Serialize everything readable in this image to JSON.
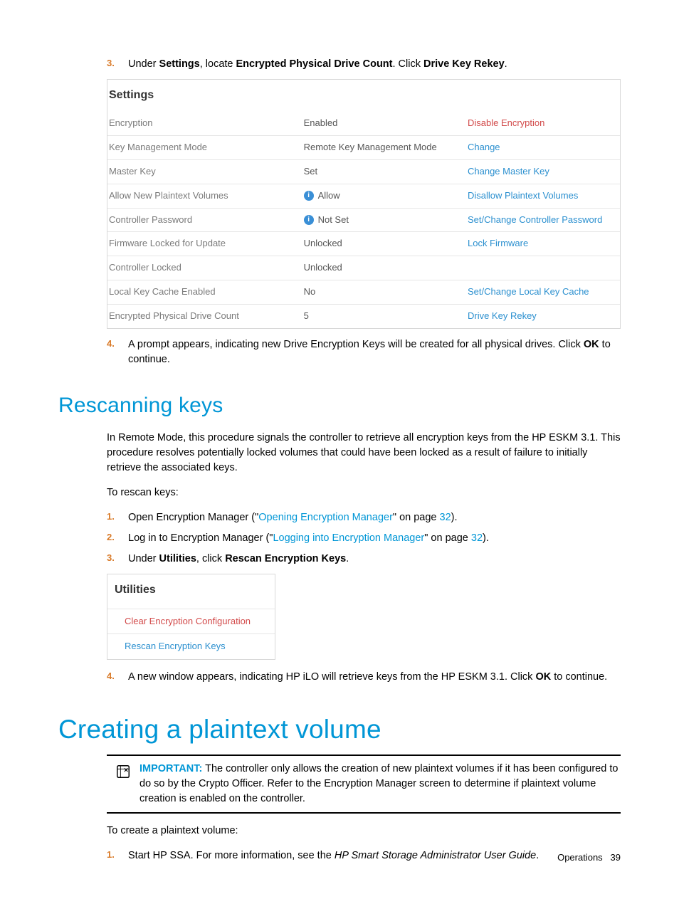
{
  "step3": {
    "num": "3.",
    "text_a": "Under ",
    "b1": "Settings",
    "text_b": ", locate ",
    "b2": "Encrypted Physical Drive Count",
    "text_c": ". Click ",
    "b3": "Drive Key Rekey",
    "text_d": "."
  },
  "settings_img": {
    "title": "Settings",
    "rows": [
      {
        "label": "Encryption",
        "value": "Enabled",
        "action": "Disable Encryption",
        "info": false,
        "red": true
      },
      {
        "label": "Key Management Mode",
        "value": "Remote Key Management Mode",
        "action": "Change",
        "info": false,
        "red": false
      },
      {
        "label": "Master Key",
        "value": "Set",
        "action": "Change Master Key",
        "info": false,
        "red": false
      },
      {
        "label": "Allow New Plaintext Volumes",
        "value": "Allow",
        "action": "Disallow Plaintext Volumes",
        "info": true,
        "red": false
      },
      {
        "label": "Controller Password",
        "value": "Not Set",
        "action": "Set/Change Controller Password",
        "info": true,
        "red": false
      },
      {
        "label": "Firmware Locked for Update",
        "value": "Unlocked",
        "action": "Lock Firmware",
        "info": false,
        "red": false
      },
      {
        "label": "Controller Locked",
        "value": "Unlocked",
        "action": "",
        "info": false,
        "red": false
      },
      {
        "label": "Local Key Cache Enabled",
        "value": "No",
        "action": "Set/Change Local Key Cache",
        "info": false,
        "red": false
      },
      {
        "label": "Encrypted Physical Drive Count",
        "value": "5",
        "action": "Drive Key Rekey",
        "info": false,
        "red": false
      }
    ]
  },
  "step4": {
    "num": "4.",
    "text_a": "A prompt appears, indicating new Drive Encryption Keys will be created for all physical drives. Click ",
    "b1": "OK",
    "text_b": " to continue."
  },
  "h2_rescanning": "Rescanning keys",
  "rescan_intro": "In Remote Mode, this procedure signals the controller to retrieve all encryption keys from the HP ESKM 3.1. This procedure resolves potentially locked volumes that could have been locked as a result of failure to initially retrieve the associated keys.",
  "rescan_to": "To rescan keys:",
  "rstep1": {
    "num": "1.",
    "text_a": "Open Encryption Manager (\"",
    "link": "Opening Encryption Manager",
    "text_b": "\" on page ",
    "page": "32",
    "text_c": ")."
  },
  "rstep2": {
    "num": "2.",
    "text_a": "Log in to Encryption Manager (\"",
    "link": "Logging into Encryption Manager",
    "text_b": "\" on page ",
    "page": "32",
    "text_c": ")."
  },
  "rstep3": {
    "num": "3.",
    "text_a": "Under ",
    "b1": "Utilities",
    "text_b": ", click ",
    "b2": "Rescan Encryption Keys",
    "text_c": "."
  },
  "utilities_img": {
    "title": "Utilities",
    "item1": "Clear Encryption Configuration",
    "item2": "Rescan Encryption Keys"
  },
  "rstep4": {
    "num": "4.",
    "text_a": "A new window appears, indicating HP iLO will retrieve keys from the HP ESKM 3.1. Click ",
    "b1": "OK",
    "text_b": " to continue."
  },
  "h1_creating": "Creating a plaintext volume",
  "important": {
    "label": "IMPORTANT:",
    "body": "   The controller only allows the creation of new plaintext volumes if it has been configured to do so by the Crypto Officer. Refer to the Encryption Manager screen to determine if plaintext volume creation is enabled on the controller."
  },
  "create_to": "To create a plaintext volume:",
  "cstep1": {
    "num": "1.",
    "text_a": "Start HP SSA. For more information, see the ",
    "ital": "HP Smart Storage Administrator User Guide",
    "text_b": "."
  },
  "footer": {
    "section": "Operations",
    "page": "39"
  }
}
